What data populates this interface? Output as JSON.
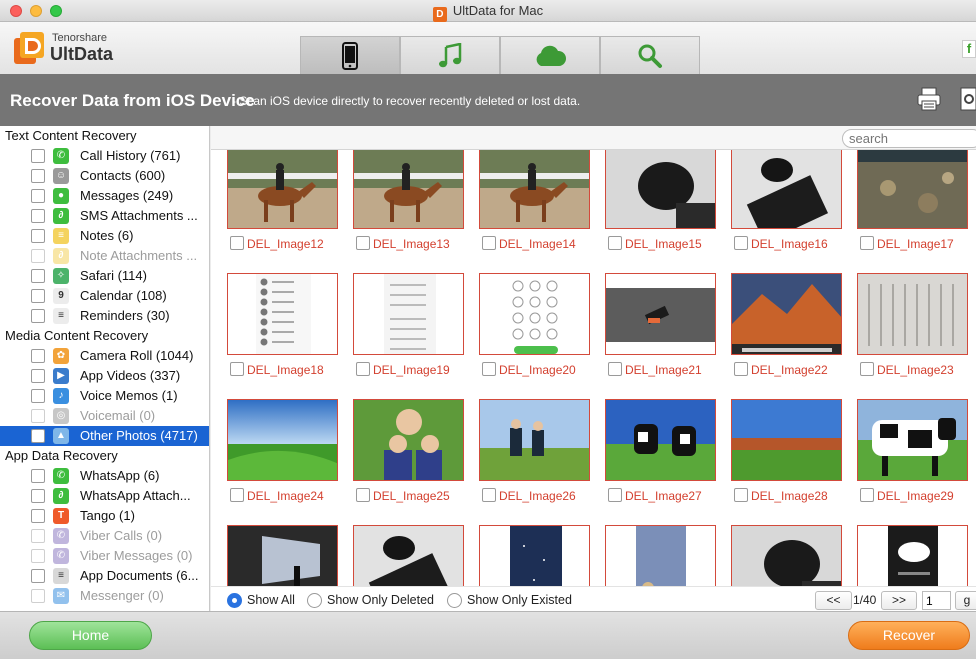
{
  "window": {
    "title": "UltData for Mac",
    "app_badge": "D"
  },
  "brand": {
    "company": "Tenorshare",
    "product": "UltData"
  },
  "tabs": [
    {
      "name": "ios-device",
      "icon": "phone-icon",
      "active": true
    },
    {
      "name": "itunes-backup",
      "icon": "music-note-icon",
      "active": false
    },
    {
      "name": "icloud-backup",
      "icon": "cloud-icon",
      "active": false
    },
    {
      "name": "repair-tools",
      "icon": "wrench-icon",
      "active": false
    }
  ],
  "social": {
    "label": "f"
  },
  "banner": {
    "title": "Recover Data from iOS Device",
    "subtitle": "- Scan iOS device directly to recover recently deleted or lost data."
  },
  "sidebar": {
    "categories": [
      {
        "title": "Text Content Recovery",
        "items": [
          {
            "label": "Call History (761)",
            "icon": "phone-icon",
            "color": "#3ebd3e",
            "disabled": false,
            "selected": false
          },
          {
            "label": "Contacts (600)",
            "icon": "contacts-icon",
            "color": "#9a9a9a",
            "disabled": false,
            "selected": false
          },
          {
            "label": "Messages (249)",
            "icon": "message-icon",
            "color": "#3ebd3e",
            "disabled": false,
            "selected": false
          },
          {
            "label": "SMS Attachments ...",
            "icon": "paperclip-icon",
            "color": "#3ebd3e",
            "disabled": false,
            "selected": false
          },
          {
            "label": "Notes (6)",
            "icon": "notes-icon",
            "color": "#f4d35e",
            "disabled": false,
            "selected": false
          },
          {
            "label": "Note Attachments ...",
            "icon": "paperclip-icon",
            "color": "#f4d35e",
            "disabled": true,
            "selected": false
          },
          {
            "label": "Safari (114)",
            "icon": "compass-icon",
            "color": "#4cb36a",
            "disabled": false,
            "selected": false
          },
          {
            "label": "Calendar (108)",
            "icon": "calendar-icon",
            "color": "#ececec",
            "disabled": false,
            "selected": false
          },
          {
            "label": "Reminders (30)",
            "icon": "reminders-icon",
            "color": "#ececec",
            "disabled": false,
            "selected": false
          }
        ]
      },
      {
        "title": "Media Content Recovery",
        "items": [
          {
            "label": "Camera Roll (1044)",
            "icon": "flower-icon",
            "color": "#f2a33a",
            "disabled": false,
            "selected": false
          },
          {
            "label": "App Videos (337)",
            "icon": "video-clapper-icon",
            "color": "#3a7ccc",
            "disabled": false,
            "selected": false
          },
          {
            "label": "Voice Memos (1)",
            "icon": "microphone-icon",
            "color": "#3a8fe0",
            "disabled": false,
            "selected": false
          },
          {
            "label": "Voicemail (0)",
            "icon": "voicemail-icon",
            "color": "#9a9a9a",
            "disabled": true,
            "selected": false
          },
          {
            "label": "Other Photos (4717)",
            "icon": "landscape-photo-icon",
            "color": "#7fb6e8",
            "disabled": false,
            "selected": true
          }
        ]
      },
      {
        "title": "App Data Recovery",
        "items": [
          {
            "label": "WhatsApp (6)",
            "icon": "whatsapp-icon",
            "color": "#3ebd3e",
            "disabled": false,
            "selected": false
          },
          {
            "label": "WhatsApp Attach...",
            "icon": "paperclip-icon",
            "color": "#3ebd3e",
            "disabled": false,
            "selected": false
          },
          {
            "label": "Tango (1)",
            "icon": "tango-icon",
            "color": "#ef5a2a",
            "disabled": false,
            "selected": false
          },
          {
            "label": "Viber Calls (0)",
            "icon": "viber-phone-icon",
            "color": "#8e7cc3",
            "disabled": true,
            "selected": false
          },
          {
            "label": "Viber Messages (0)",
            "icon": "viber-icon",
            "color": "#8e7cc3",
            "disabled": true,
            "selected": false
          },
          {
            "label": "App Documents (6...",
            "icon": "document-icon",
            "color": "#d8d8d8",
            "disabled": false,
            "selected": false
          },
          {
            "label": "Messenger (0)",
            "icon": "messenger-icon",
            "color": "#3a8fe0",
            "disabled": true,
            "selected": false
          }
        ]
      }
    ]
  },
  "search": {
    "placeholder": "search"
  },
  "thumbnails": [
    {
      "label": "DEL_Image12",
      "scene": "horse-rider"
    },
    {
      "label": "DEL_Image13",
      "scene": "horse-rider"
    },
    {
      "label": "DEL_Image14",
      "scene": "horse-rider"
    },
    {
      "label": "DEL_Image15",
      "scene": "mouse-closeup"
    },
    {
      "label": "DEL_Image16",
      "scene": "keyboard-mouse"
    },
    {
      "label": "DEL_Image17",
      "scene": "aerial-game"
    },
    {
      "label": "DEL_Image18",
      "scene": "contacts-screen"
    },
    {
      "label": "DEL_Image19",
      "scene": "keypad-screen"
    },
    {
      "label": "DEL_Image20",
      "scene": "dial-screen"
    },
    {
      "label": "DEL_Image21",
      "scene": "grey-object"
    },
    {
      "label": "DEL_Image22",
      "scene": "desktop-wallpaper"
    },
    {
      "label": "DEL_Image23",
      "scene": "grid-pattern"
    },
    {
      "label": "DEL_Image24",
      "scene": "green-field"
    },
    {
      "label": "DEL_Image25",
      "scene": "family-outdoor"
    },
    {
      "label": "DEL_Image26",
      "scene": "kids-field"
    },
    {
      "label": "DEL_Image27",
      "scene": "cows-field"
    },
    {
      "label": "DEL_Image28",
      "scene": "autumn-field"
    },
    {
      "label": "DEL_Image29",
      "scene": "cow-closeup"
    },
    {
      "label": "",
      "scene": "presentation-room"
    },
    {
      "label": "",
      "scene": "keyboard-mouse"
    },
    {
      "label": "",
      "scene": "night-sky"
    },
    {
      "label": "",
      "scene": "bokeh-lights"
    },
    {
      "label": "",
      "scene": "mouse-closeup"
    },
    {
      "label": "",
      "scene": "dark-phone"
    }
  ],
  "filters": {
    "show_all": "Show All",
    "show_only_deleted": "Show Only Deleted",
    "show_only_existed": "Show Only Existed",
    "selected": "show_all"
  },
  "pagination": {
    "prev": "<<",
    "page_text": "1/40",
    "next": ">>",
    "page_input": "1",
    "go": "g"
  },
  "bottom": {
    "home": "Home",
    "recover": "Recover"
  }
}
